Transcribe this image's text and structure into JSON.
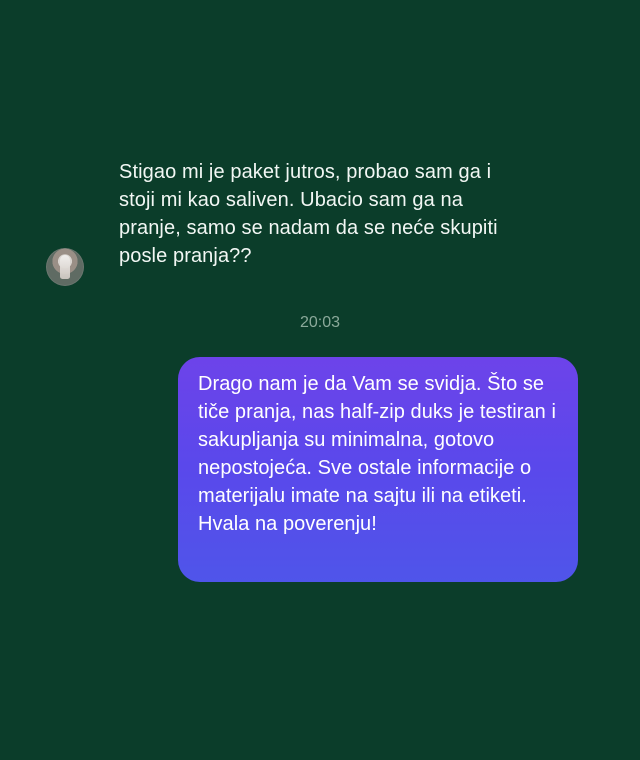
{
  "conversation": {
    "incoming_message": {
      "avatar_icon": "user-avatar-icon",
      "text": "Stigao mi je paket jutros, probao sam ga i stoji mi kao saliven. Ubacio sam ga na pranje, samo se nadam da se neće skupiti posle pranja??"
    },
    "timestamp": "20:03",
    "outgoing_message": {
      "text": "Drago nam je da Vam se svidja. Što se tiče pranja, nas half-zip duks je testiran i sakupljanja su minimalna, gotovo nepostojeća. Sve ostale informacije o materijalu imate na sajtu ili na etiketi. Hvala na poverenju!"
    }
  },
  "colors": {
    "background": "#0b3d2a",
    "incoming_text": "#f2f7f4",
    "timestamp_text": "#8ba99a",
    "outgoing_bubble_top": "#6d43ea",
    "outgoing_bubble_bottom": "#4f55ea",
    "outgoing_text": "#ffffff"
  }
}
